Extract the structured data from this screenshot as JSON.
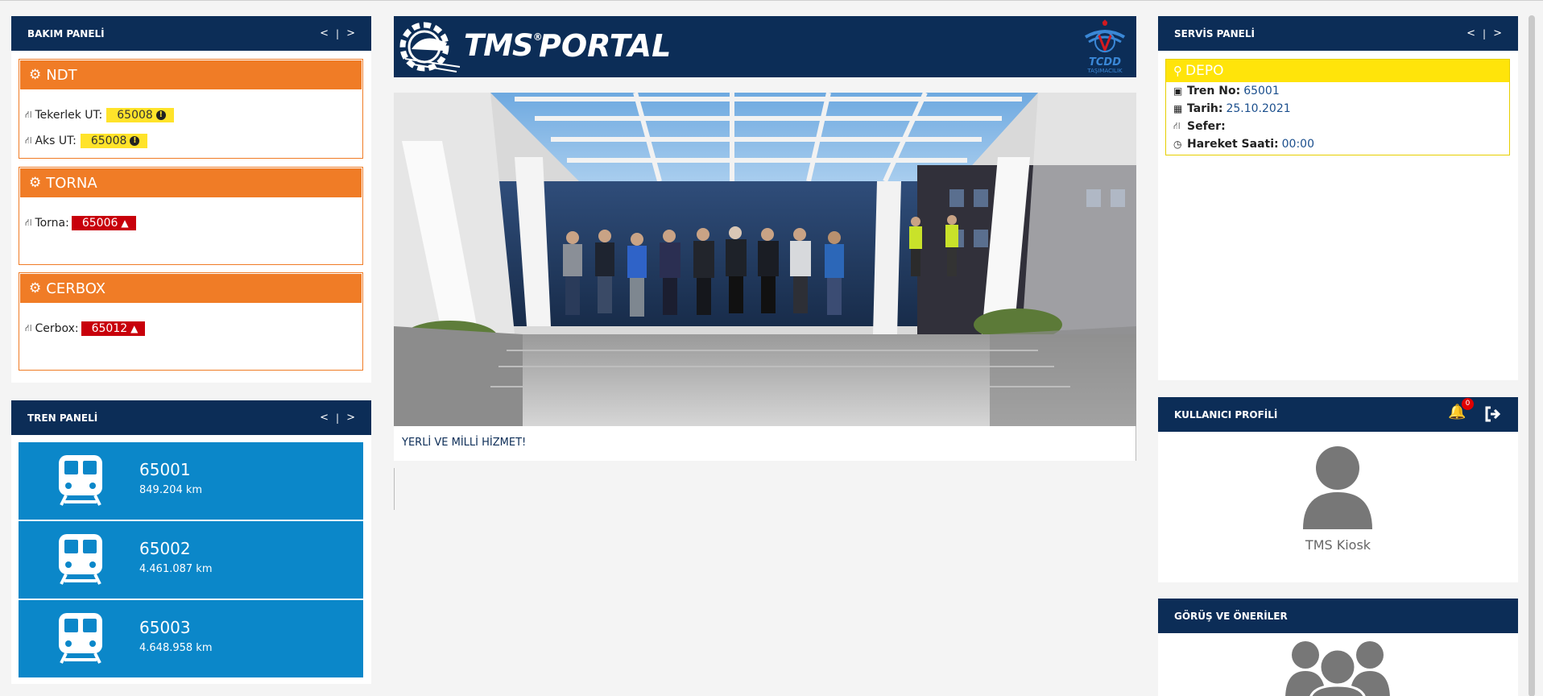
{
  "maintenance_panel": {
    "title": "BAKIM PANELİ",
    "nav_prev": "<",
    "nav_sep": "|",
    "nav_next": ">",
    "sections": [
      {
        "title": "NDT",
        "rows": [
          {
            "label": "Tekerlek UT:",
            "value": "65008",
            "status": "warning"
          },
          {
            "label": "Aks UT:",
            "value": "65008",
            "status": "warning"
          }
        ]
      },
      {
        "title": "TORNA",
        "rows": [
          {
            "label": "Torna:",
            "value": "65006",
            "status": "alert"
          }
        ]
      },
      {
        "title": "CERBOX",
        "rows": [
          {
            "label": "Cerbox:",
            "value": "65012",
            "status": "alert"
          }
        ]
      }
    ]
  },
  "train_panel": {
    "title": "TREN PANELİ",
    "nav_prev": "<",
    "nav_sep": "|",
    "nav_next": ">",
    "trains": [
      {
        "name": "65001",
        "km": "849.204 km"
      },
      {
        "name": "65002",
        "km": "4.461.087 km"
      },
      {
        "name": "65003",
        "km": "4.648.958 km"
      }
    ]
  },
  "banner": {
    "brand_tms": "TMS",
    "brand_reg": "®",
    "brand_portal": "PORTAL",
    "logo_text_top": "TCDD",
    "logo_text_bottom": "TAŞIMACILIK"
  },
  "news": {
    "caption": "YERLİ VE MİLLİ HİZMET!"
  },
  "service_panel": {
    "title": "SERVİS PANELİ",
    "nav_prev": "<",
    "nav_sep": "|",
    "nav_next": ">",
    "depo_title": "DEPO",
    "rows": [
      {
        "label": "Tren No:",
        "value": "65001"
      },
      {
        "label": "Tarih:",
        "value": "25.10.2021"
      },
      {
        "label": "Sefer:",
        "value": ""
      },
      {
        "label": "Hareket Saati:",
        "value": "00:00"
      }
    ]
  },
  "user_profile": {
    "title": "KULLANICI PROFİLİ",
    "notification_count": "0",
    "user_name": "TMS Kiosk"
  },
  "feedback": {
    "title": "GÖRÜŞ VE ÖNERİLER"
  },
  "colors": {
    "navy": "#0c2d57",
    "orange": "#f07c26",
    "train_blue": "#0b87c9",
    "warning_yellow": "#ffe32a",
    "alert_red": "#c8000b"
  }
}
